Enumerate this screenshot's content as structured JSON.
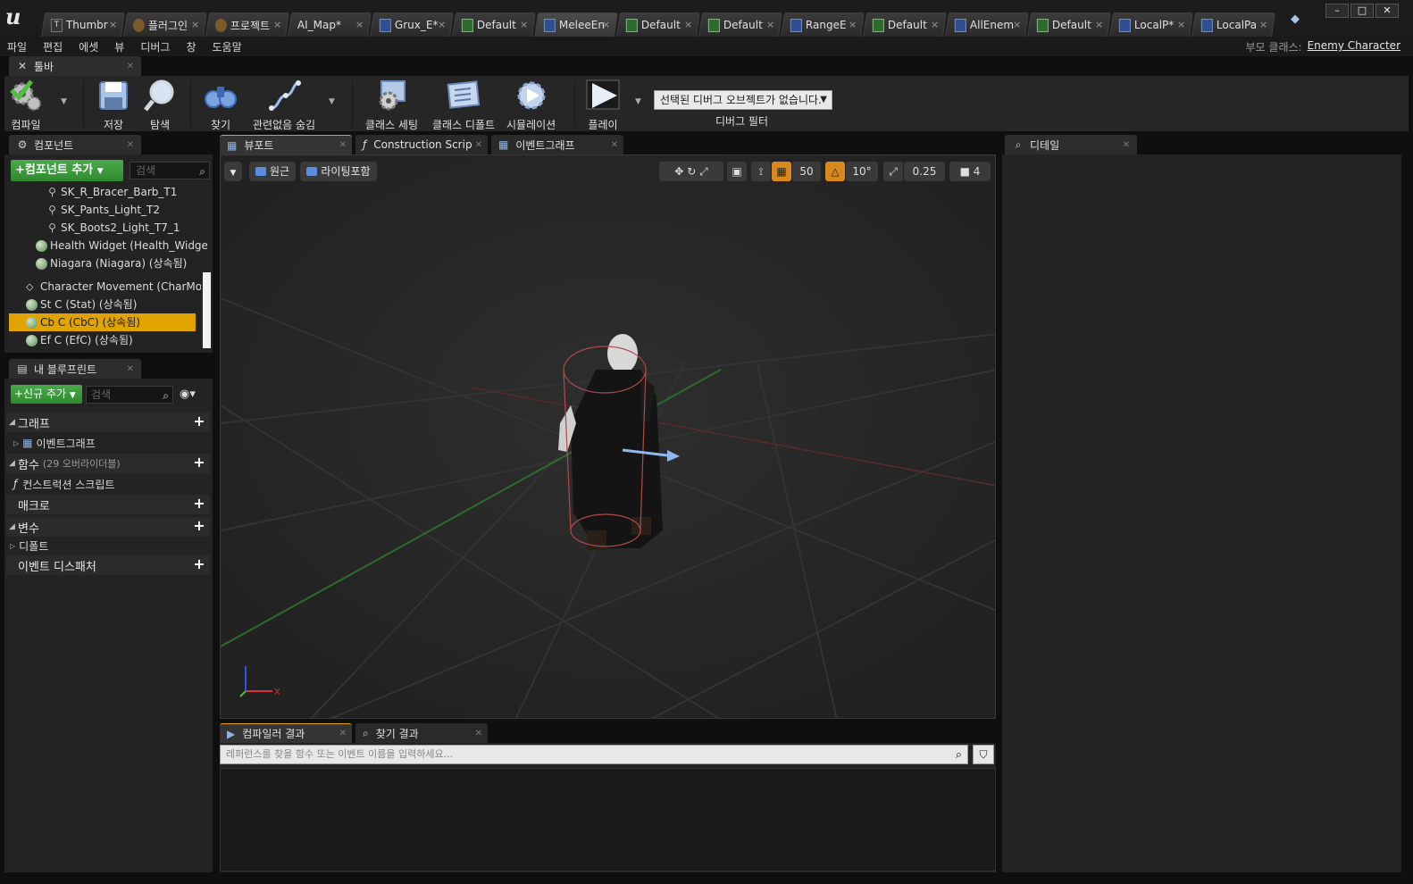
{
  "title_bar": {
    "tabs": [
      {
        "label": "Thumbr",
        "icon": "texture-icon"
      },
      {
        "label": "플러그인",
        "icon": "plugin-icon"
      },
      {
        "label": "프로젝트",
        "icon": "settings-icon"
      },
      {
        "label": "AI_Map*",
        "icon": "map-icon"
      },
      {
        "label": "Grux_E*",
        "icon": "blueprint-icon"
      },
      {
        "label": "Default",
        "icon": "character-icon"
      },
      {
        "label": "MeleeEn",
        "icon": "blueprint-icon"
      },
      {
        "label": "Default",
        "icon": "character-icon"
      },
      {
        "label": "Default",
        "icon": "character-icon"
      },
      {
        "label": "RangeE",
        "icon": "blueprint-icon"
      },
      {
        "label": "Default",
        "icon": "character-icon"
      },
      {
        "label": "AllEnem",
        "icon": "blueprint-icon"
      },
      {
        "label": "Default",
        "icon": "character-icon"
      },
      {
        "label": "LocalP*",
        "icon": "blueprint-icon"
      },
      {
        "label": "LocalPa",
        "icon": "blueprint-icon"
      }
    ],
    "active_tab_index": 6,
    "window_buttons": [
      "minimize",
      "maximize",
      "close"
    ]
  },
  "menu": {
    "items": [
      "파일",
      "편집",
      "에셋",
      "뷰",
      "디버그",
      "창",
      "도움말"
    ],
    "parent_class_label": "부모 클래스:",
    "parent_class_value": "Enemy Character"
  },
  "toolbar": {
    "tab_label": "툴바",
    "buttons": {
      "compile": "컴파일",
      "save": "저장",
      "browse": "탐색",
      "find": "찾기",
      "hide_unrelated": "관련없음 숨김",
      "class_settings": "클래스 세팅",
      "class_defaults": "클래스 디폴트",
      "simulation": "시뮬레이션",
      "play": "플레이"
    },
    "debug_select": "선택된 디버그 오브젝트가 없습니다.",
    "debug_filter_label": "디버그 필터"
  },
  "components": {
    "tab_label": "컴포넌트",
    "add_button": "+컴포넌트 추가",
    "search_placeholder": "검색",
    "items": [
      {
        "label": "SK_R_Bracer_Barb_T1",
        "icon": "bone-icon"
      },
      {
        "label": "SK_Pants_Light_T2",
        "icon": "bone-icon"
      },
      {
        "label": "SK_Boots2_Light_T7_1",
        "icon": "bone-icon"
      },
      {
        "label": "Health Widget (Health_Widget)",
        "icon": "sphere-icon"
      },
      {
        "label": "Niagara (Niagara) (상속됨)",
        "icon": "sphere-icon"
      },
      {
        "label": "Character Movement (CharMove",
        "icon": "movement-icon"
      },
      {
        "label": "St C (Stat) (상속됨)",
        "icon": "sphere-icon"
      },
      {
        "label": "Cb C (CbC) (상속됨)",
        "icon": "sphere-icon",
        "selected": true
      },
      {
        "label": "Ef C (EfC) (상속됨)",
        "icon": "sphere-icon"
      }
    ]
  },
  "my_blueprint": {
    "tab_label": "내 블루프린트",
    "add_new_button": "+신규 추가",
    "search_placeholder": "검색",
    "graph_label": "그래프",
    "event_graph_label": "이벤트그래프",
    "functions_label": "함수",
    "functions_count": "(29 오버라이더블)",
    "construction_script_label": "컨스트럭션 스크립트",
    "macros_label": "매크로",
    "variables_label": "변수",
    "defaults_label": "디폴트",
    "event_dispatchers_label": "이벤트 디스패처"
  },
  "editor_tabs": {
    "viewport": "뷰포트",
    "construction_script": "Construction Scrip",
    "event_graph": "이벤트그래프"
  },
  "viewport": {
    "perspective": "원근",
    "lit": "라이팅포함",
    "grid_snap": "50",
    "rotation_snap": "10°",
    "scale_snap": "0.25",
    "camera_speed": "4",
    "axis_x": "X"
  },
  "results": {
    "compiler_tab": "컴파일러 결과",
    "find_tab": "찾기 결과",
    "search_placeholder": "레퍼런스를 찾을 함수 또는 이벤트 이름을 입력하세요..."
  },
  "details": {
    "tab_label": "디테일"
  },
  "colors": {
    "accent_selected": "#e0a300",
    "green_button": "#3a9a3a",
    "background": "#232323"
  }
}
